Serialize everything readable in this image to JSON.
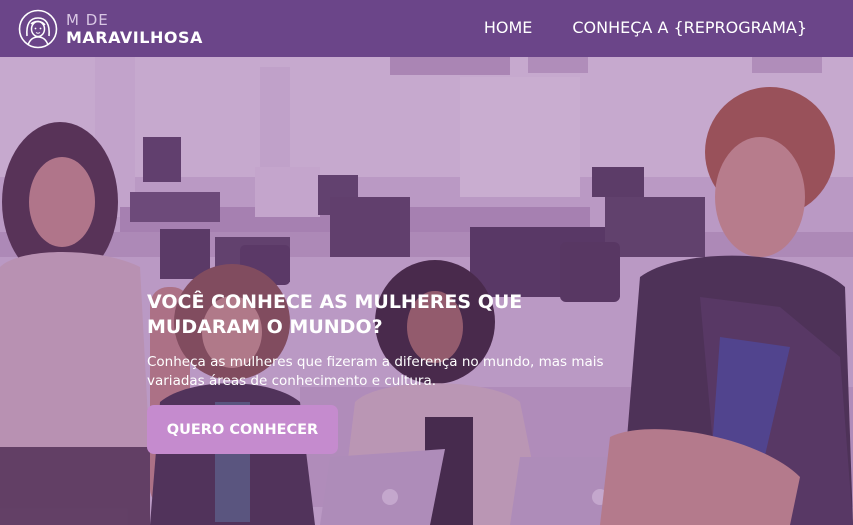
{
  "header": {
    "logo": {
      "line1": "M DE",
      "line2": "MARAVILHOSA",
      "icon": "woman-face-icon"
    },
    "nav": [
      {
        "label": "HOME"
      },
      {
        "label": "CONHEÇA A {REPROGRAMA}"
      }
    ]
  },
  "hero": {
    "title": "VOCÊ CONHECE AS MULHERES QUE MUDARAM O MUNDO?",
    "description": "Conheça as mulheres que fizeram a diferença no mundo, mas mais variadas áreas de conhecimento e cultura.",
    "cta_label": "QUERO CONHECER",
    "image": "photo-four-women-in-office"
  },
  "colors": {
    "header_bg": "#6b4589",
    "overlay": "#8a4d9b",
    "button_bg": "#c58bce",
    "text": "#ffffff"
  }
}
